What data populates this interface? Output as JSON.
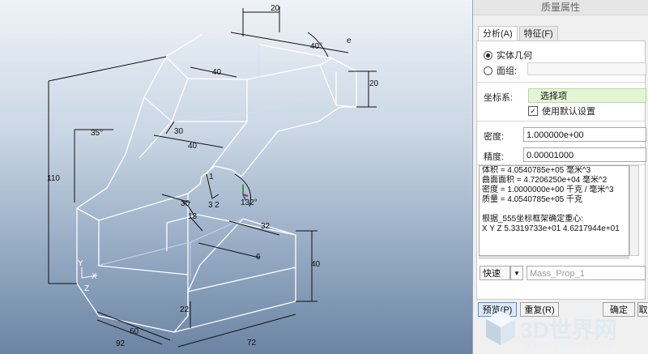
{
  "dialog": {
    "title": "质量属性",
    "tabs": [
      {
        "label": "分析(A)"
      },
      {
        "label": "特征(F)"
      }
    ],
    "geometry": {
      "solid_label": "实体几何",
      "quilt_label": "面组:"
    },
    "coord": {
      "label": "坐标系:",
      "value": "选择项",
      "use_default_label": "使用默认设置"
    },
    "density": {
      "label": "密度:",
      "value": "1.000000e+00"
    },
    "accuracy": {
      "label": "精度:",
      "value": "0.00001000"
    },
    "results": [
      "体积 =  4.0540785e+05  毫米^3",
      "曲面面积 =  4.7206250e+04  毫米^2",
      "密度 =  1.0000000e+00 千克 / 毫米^3",
      "质量 =  4.0540785e+05 千克",
      "",
      "根据_555坐标框架确定重心:",
      "X  Y  Z     5.3319733e+01  4.6217944e+01"
    ],
    "mode": {
      "value": "快速",
      "name_value": "Mass_Prop_1"
    },
    "buttons": {
      "preview": "预览(P)",
      "repeat": "重复(R)",
      "ok": "确定",
      "cancel": "取"
    }
  },
  "drawing": {
    "dims": {
      "top20": "20",
      "d40a": "40°",
      "r20": "20",
      "d35": "35°",
      "h110": "110",
      "d30": "30",
      "d13": "13",
      "d132": "132°",
      "d32": "32",
      "h40": "40",
      "h22": "22",
      "w60": "60",
      "w72": "72",
      "w92": "92",
      "d3": "3",
      "d2": "2",
      "d1": "1",
      "d6": "6",
      "a40": "40",
      "a40b": "40",
      "a30": "30",
      "e": "e"
    },
    "axes": {
      "y": "Y",
      "x": "X",
      "z": "Z"
    }
  },
  "watermark": {
    "brand": "3D世界网",
    "url": "WWW.3DSJW.COM"
  },
  "colors": {
    "model_edge": "#ffffff",
    "dim_line": "#111111",
    "accent": "#1a6fd0"
  }
}
